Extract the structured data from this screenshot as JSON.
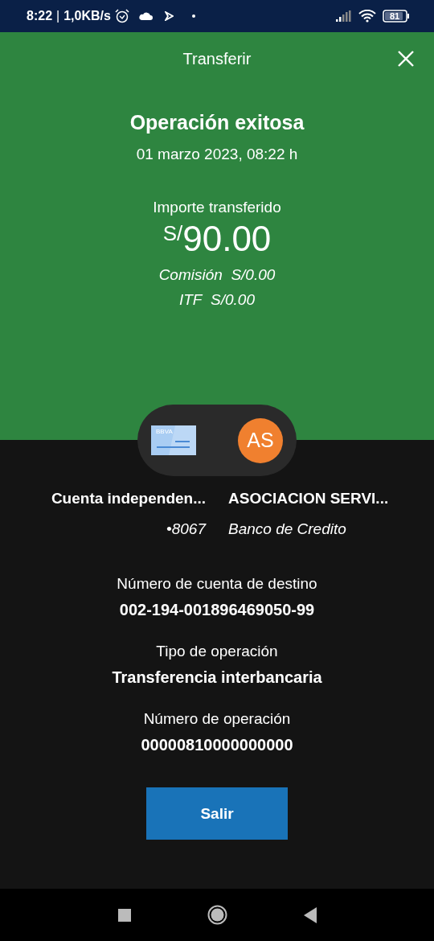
{
  "status_bar": {
    "time": "8:22",
    "separator": "|",
    "speed": "1,0KB/s",
    "battery": "81"
  },
  "header": {
    "title": "Transferir"
  },
  "result": {
    "title": "Operación exitosa",
    "date": "01 marzo 2023, 08:22 h",
    "amount_label": "Importe transferido",
    "currency": "S/",
    "amount": "90.00",
    "fees": [
      {
        "label": "Comisión",
        "value": "S/0.00"
      },
      {
        "label": "ITF",
        "value": "S/0.00"
      }
    ]
  },
  "transfer": {
    "card_brand": "BBVA",
    "initials": "AS",
    "origin": {
      "name": "Cuenta independen...",
      "detail": "•8067"
    },
    "destination": {
      "name": "ASOCIACION SERVI...",
      "detail": "Banco de Credito"
    }
  },
  "details": [
    {
      "label": "Número de cuenta de destino",
      "value": "002-194-001896469050-99"
    },
    {
      "label": "Tipo de operación",
      "value": "Transferencia interbancaria"
    },
    {
      "label": "Número de operación",
      "value": "00000810000000000"
    }
  ],
  "button": "Salir"
}
